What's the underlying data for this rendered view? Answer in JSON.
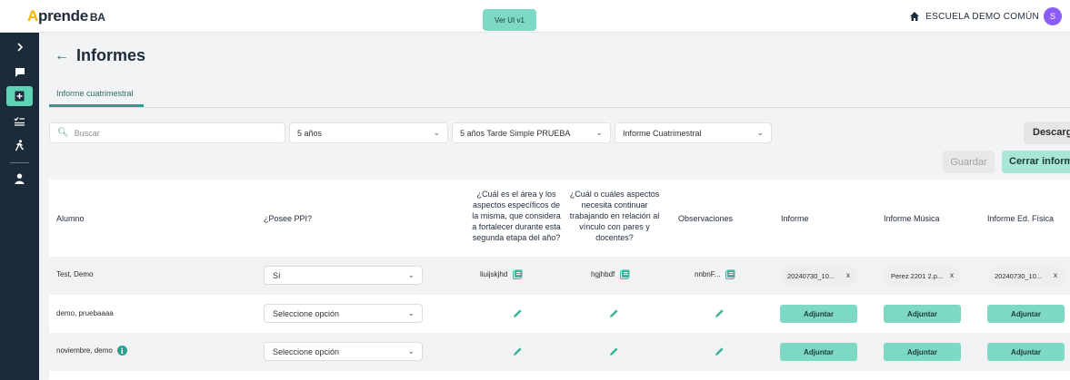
{
  "topbar": {
    "logo_main": "prende",
    "logo_prefix": "A",
    "logo_suffix": "BA",
    "version_label": "Ver UI v1",
    "school_name": "ESCUELA DEMO COMÚN",
    "avatar_initial": "S"
  },
  "sidebar": {
    "icons": [
      "chevron-right-icon",
      "chat-icon",
      "add-document-icon",
      "list-check-icon",
      "person-running-icon",
      "user-icon"
    ],
    "active_index": 2,
    "accent": "#5fd1b4",
    "background": "#1b2b3a"
  },
  "page": {
    "back_symbol": "←",
    "title": "Informes",
    "tab_label": "Informe cuatrimestral"
  },
  "filters": {
    "search_placeholder": "Buscar",
    "age": "5 años",
    "section": "5 años Tarde Simple PRUEBA",
    "report_type": "Informe Cuatrimestral"
  },
  "actions": {
    "download": "Descarga",
    "save": "Guardar",
    "close_report": "Cerrar informe"
  },
  "table": {
    "headers": {
      "student": "Alumno",
      "ppi": "¿Posee PPI?",
      "q1_lines": [
        "¿Cuál es el área y los",
        "aspectos específicos de",
        "la misma, que considera",
        "a fortalecer durante esta",
        "segunda etapa del año?"
      ],
      "q2_lines": [
        "¿Cuál o cuáles aspectos",
        "necesita continuar",
        "trabajando en relación al",
        "vínculo con pares y",
        "docentes?"
      ],
      "observations": "Observaciones",
      "report": "Informe",
      "music_report": "Informe Música",
      "pe_report": "Informe Ed. Física"
    },
    "rows": [
      {
        "student": "Test, Demo",
        "ppi": "Sí",
        "q1": "liuijskjhd",
        "q2": "hgjhbdf",
        "observations": "nnbnF...",
        "report": "20240730_10...",
        "music_report": "Perez 2201 2.p...",
        "pe_report": "20240730_10..."
      },
      {
        "student": "demo, pruebaaaa",
        "ppi": "Seleccione opción",
        "attach_label": "Adjuntar"
      },
      {
        "student": "noviembre, demo",
        "ppi": "Seleccione opción",
        "attach_label": "Adjuntar"
      }
    ],
    "chip_remove": "x"
  },
  "colors": {
    "primary": "#2a9d8f",
    "button_accent": "#7dd8c4",
    "close_button": "#a8e6d6",
    "avatar": "#8b5cf6"
  }
}
